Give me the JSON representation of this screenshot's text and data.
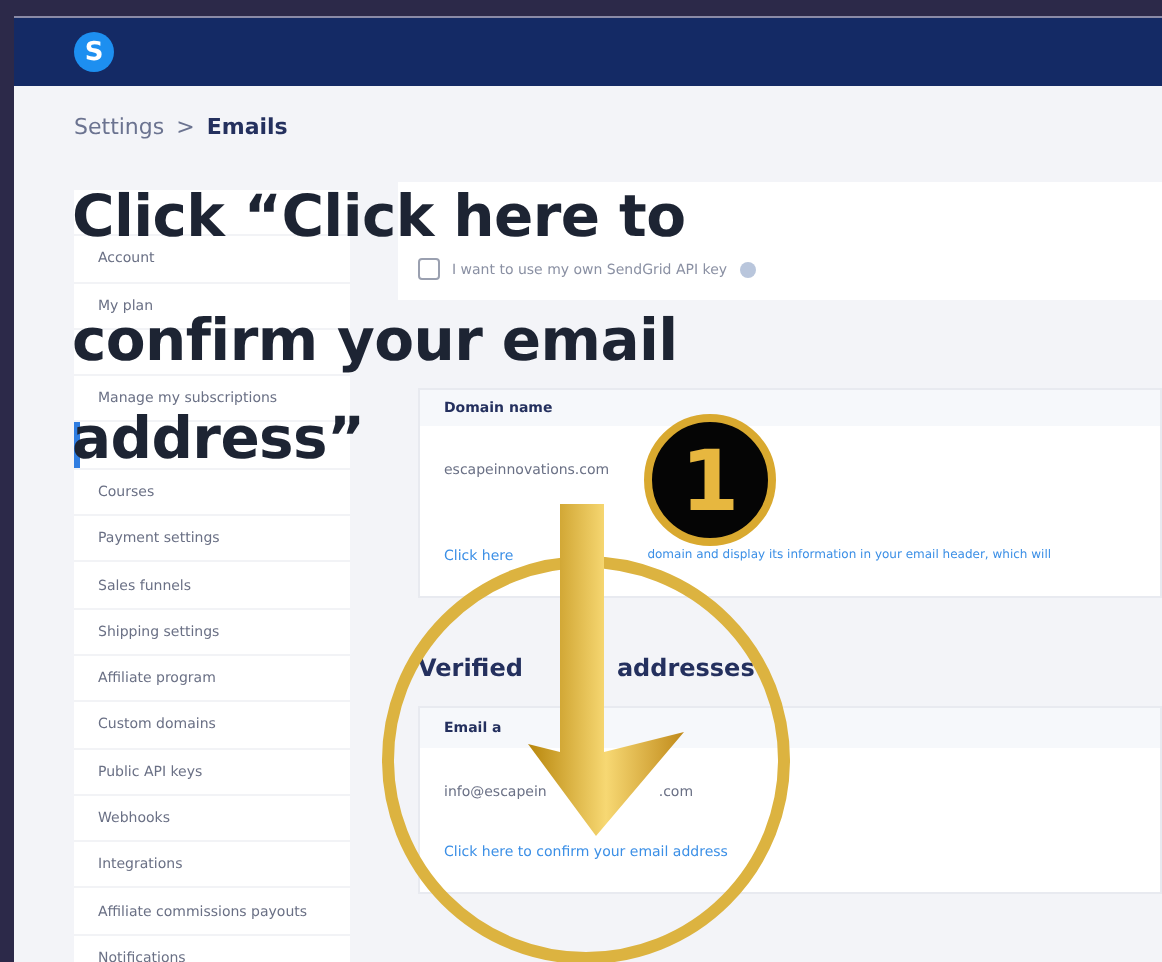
{
  "app_bar": {
    "logo": "S"
  },
  "breadcrumb": {
    "parent": "Settings",
    "separator": ">",
    "current": "Emails"
  },
  "sidebar": {
    "items": [
      {
        "selected": false
      },
      {
        "label": "Account",
        "selected": false
      },
      {
        "label": "My plan",
        "selected": false
      },
      {
        "selected": false
      },
      {
        "label": "Manage my subscriptions",
        "selected": false
      },
      {
        "selected": true
      },
      {
        "label": "Courses",
        "selected": false
      },
      {
        "label": "Payment settings",
        "selected": false
      },
      {
        "label": "Sales funnels",
        "selected": false
      },
      {
        "label": "Shipping settings",
        "selected": false
      },
      {
        "label": "Affiliate program",
        "selected": false
      },
      {
        "label": "Custom domains",
        "selected": false
      },
      {
        "label": "Public API keys",
        "selected": false
      },
      {
        "label": "Webhooks",
        "selected": false
      },
      {
        "label": "Integrations",
        "selected": false
      },
      {
        "label": "Affiliate commissions payouts",
        "selected": false
      },
      {
        "label": "Notifications",
        "selected": false
      }
    ]
  },
  "sendgrid": {
    "checkbox": {
      "label": "I want to use my own SendGrid API key",
      "checked": false
    }
  },
  "domain": {
    "column": "Domain name",
    "value": "escapeinnovations.com",
    "link_start": "Click here",
    "link_end": "domain and display its information in your email header, which will"
  },
  "verified": {
    "heading_start": "Verified",
    "heading_end": "addresses",
    "column": "Email a",
    "value_start": "info@escapein",
    "value_end": ".com",
    "link": "Click here to confirm your email address"
  },
  "overlay": {
    "instruction_lines": [
      "Click “Click here to",
      "confirm your email",
      "address”"
    ],
    "step": "1"
  }
}
